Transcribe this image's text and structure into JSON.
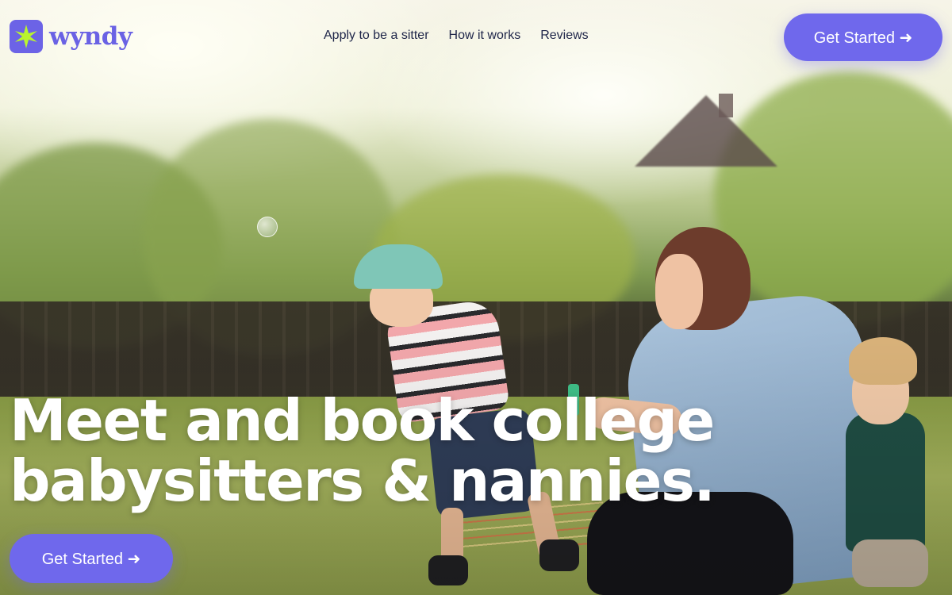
{
  "brand": {
    "name": "wyndy",
    "color": "#6c63e6"
  },
  "nav": {
    "items": [
      {
        "label": "Apply to be a sitter"
      },
      {
        "label": "How it works"
      },
      {
        "label": "Reviews"
      }
    ]
  },
  "header": {
    "cta_label": "Get Started ➜"
  },
  "hero": {
    "title_line1": "Meet and book college",
    "title_line2": "babysitters & nannies.",
    "cta_label": "Get Started ➜"
  },
  "colors": {
    "accent": "#6f68ec",
    "nav_text": "#20274a",
    "hero_text": "#ffffff"
  },
  "icons": {
    "logo": "sparkle-star-icon"
  }
}
